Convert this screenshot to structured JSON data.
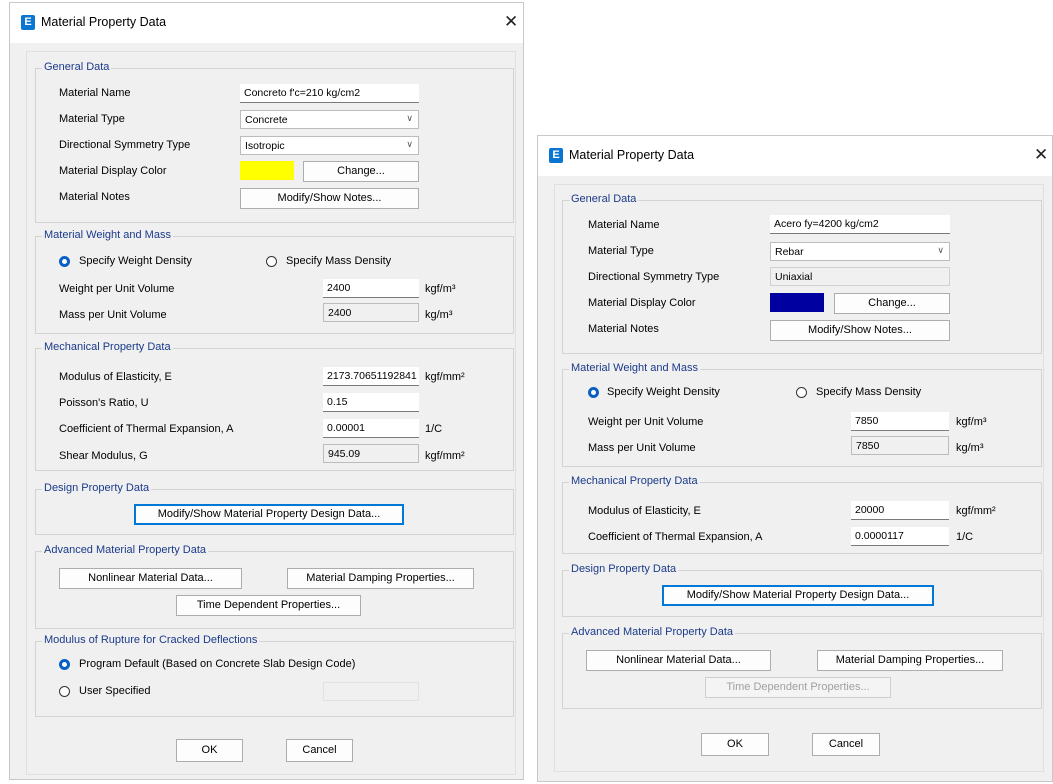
{
  "left": {
    "title": "Material Property Data",
    "general": {
      "label": "General Data",
      "name_label": "Material Name",
      "name_value": "Concreto f'c=210 kg/cm2",
      "type_label": "Material Type",
      "type_value": "Concrete",
      "sym_label": "Directional Symmetry Type",
      "sym_value": "Isotropic",
      "color_label": "Material Display Color",
      "color_hex": "#ffff00",
      "change_btn": "Change...",
      "notes_label": "Material Notes",
      "notes_btn": "Modify/Show Notes..."
    },
    "weight": {
      "label": "Material Weight and Mass",
      "opt_weight": "Specify Weight Density",
      "opt_mass": "Specify Mass Density",
      "wpu_label": "Weight per Unit Volume",
      "wpu_value": "2400",
      "wpu_unit": "kgf/m³",
      "mpu_label": "Mass per Unit Volume",
      "mpu_value": "2400",
      "mpu_unit": "kg/m³"
    },
    "mech": {
      "label": "Mechanical Property Data",
      "e_label": "Modulus of Elasticity,  E",
      "e_value": "2173.70651192841",
      "e_unit": "kgf/mm²",
      "u_label": "Poisson's Ratio,  U",
      "u_value": "0.15",
      "a_label": "Coefficient of Thermal Expansion,  A",
      "a_value": "0.00001",
      "a_unit": "1/C",
      "g_label": "Shear Modulus,  G",
      "g_value": "945.09",
      "g_unit": "kgf/mm²"
    },
    "design": {
      "label": "Design Property Data",
      "btn": "Modify/Show Material Property Design Data..."
    },
    "advanced": {
      "label": "Advanced Material Property Data",
      "nonlinear_btn": "Nonlinear Material Data...",
      "damping_btn": "Material Damping Properties...",
      "time_btn": "Time Dependent Properties..."
    },
    "rupture": {
      "label": "Modulus of Rupture for Cracked Deflections",
      "opt_default": "Program Default  (Based on Concrete Slab Design Code)",
      "opt_user": "User Specified"
    },
    "ok_btn": "OK",
    "cancel_btn": "Cancel"
  },
  "right": {
    "title": "Material Property Data",
    "general": {
      "label": "General Data",
      "name_label": "Material Name",
      "name_value": "Acero fy=4200 kg/cm2",
      "type_label": "Material Type",
      "type_value": "Rebar",
      "sym_label": "Directional Symmetry Type",
      "sym_value": "Uniaxial",
      "color_label": "Material Display Color",
      "color_hex": "#0000a0",
      "change_btn": "Change...",
      "notes_label": "Material Notes",
      "notes_btn": "Modify/Show Notes..."
    },
    "weight": {
      "label": "Material Weight and Mass",
      "opt_weight": "Specify Weight Density",
      "opt_mass": "Specify Mass Density",
      "wpu_label": "Weight per Unit Volume",
      "wpu_value": "7850",
      "wpu_unit": "kgf/m³",
      "mpu_label": "Mass per Unit Volume",
      "mpu_value": "7850",
      "mpu_unit": "kg/m³"
    },
    "mech": {
      "label": "Mechanical Property Data",
      "e_label": "Modulus of Elasticity,  E",
      "e_value": "20000",
      "e_unit": "kgf/mm²",
      "a_label": "Coefficient of Thermal Expansion,  A",
      "a_value": "0.0000117",
      "a_unit": "1/C"
    },
    "design": {
      "label": "Design Property Data",
      "btn": "Modify/Show Material Property Design Data..."
    },
    "advanced": {
      "label": "Advanced Material Property Data",
      "nonlinear_btn": "Nonlinear Material Data...",
      "damping_btn": "Material Damping Properties...",
      "time_btn": "Time Dependent Properties..."
    },
    "ok_btn": "OK",
    "cancel_btn": "Cancel"
  },
  "icons": {
    "app": "E",
    "close": "✕",
    "chevron": "∨"
  }
}
